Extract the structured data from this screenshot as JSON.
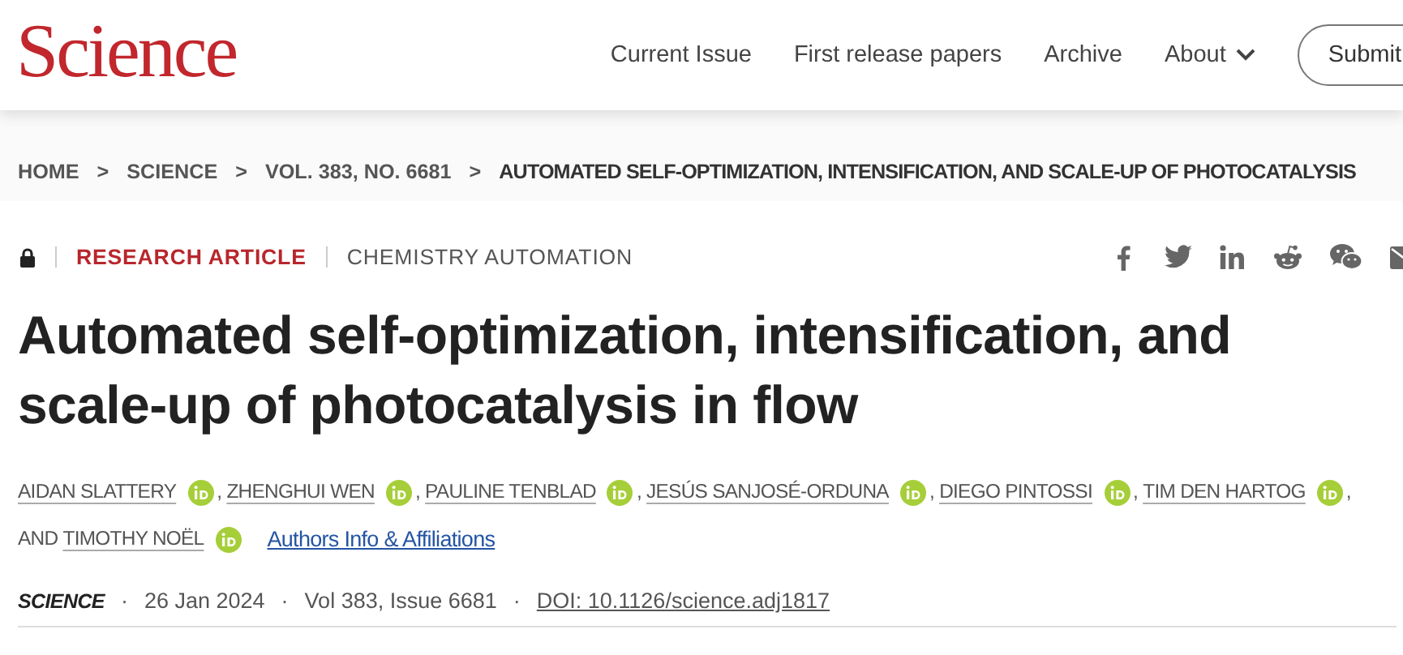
{
  "header": {
    "logo": "Science",
    "nav": [
      {
        "label": "Current Issue",
        "has_menu": false
      },
      {
        "label": "First release papers",
        "has_menu": false
      },
      {
        "label": "Archive",
        "has_menu": false
      },
      {
        "label": "About",
        "has_menu": true
      }
    ],
    "submit_button": "Submit"
  },
  "breadcrumb": [
    {
      "label": "HOME",
      "separator": ">"
    },
    {
      "label": "SCIENCE",
      "separator": ">"
    },
    {
      "label": "VOL. 383, NO. 6681",
      "separator": ">"
    },
    {
      "label": "AUTOMATED SELF-OPTIMIZATION, INTENSIFICATION, AND SCALE-UP OF PHOTOCATALYSIS"
    }
  ],
  "article": {
    "locked": true,
    "type": "RESEARCH ARTICLE",
    "category": "CHEMISTRY AUTOMATION",
    "share": [
      {
        "kind": "facebook"
      },
      {
        "kind": "twitter"
      },
      {
        "kind": "linkedin"
      },
      {
        "kind": "reddit"
      },
      {
        "kind": "wechat"
      },
      {
        "kind": "mail"
      }
    ],
    "title": "Automated self-optimization, intensification, and scale-up of photocatalysis in flow",
    "authors": [
      {
        "name": "AIDAN SLATTERY",
        "suffix": ","
      },
      {
        "name": "ZHENGHUI WEN",
        "suffix": ","
      },
      {
        "name": "PAULINE TENBLAD",
        "suffix": ","
      },
      {
        "name": "JESÚS SANJOSÉ-ORDUNA",
        "suffix": ","
      },
      {
        "name": "DIEGO PINTOSSI",
        "suffix": ","
      },
      {
        "name": "TIM DEN HARTOG",
        "suffix": ","
      },
      {
        "prefix": "AND",
        "name": "TIMOTHY NOËL"
      }
    ],
    "affiliations_link": "Authors Info & Affiliations",
    "meta": {
      "journal": "SCIENCE",
      "items": [
        {
          "text": "26 Jan 2024",
          "link": false
        },
        {
          "text": "Vol 383, Issue 6681",
          "link": false
        },
        {
          "text": "DOI: 10.1126/science.adj1817",
          "link": true
        }
      ],
      "separator": "·"
    }
  }
}
